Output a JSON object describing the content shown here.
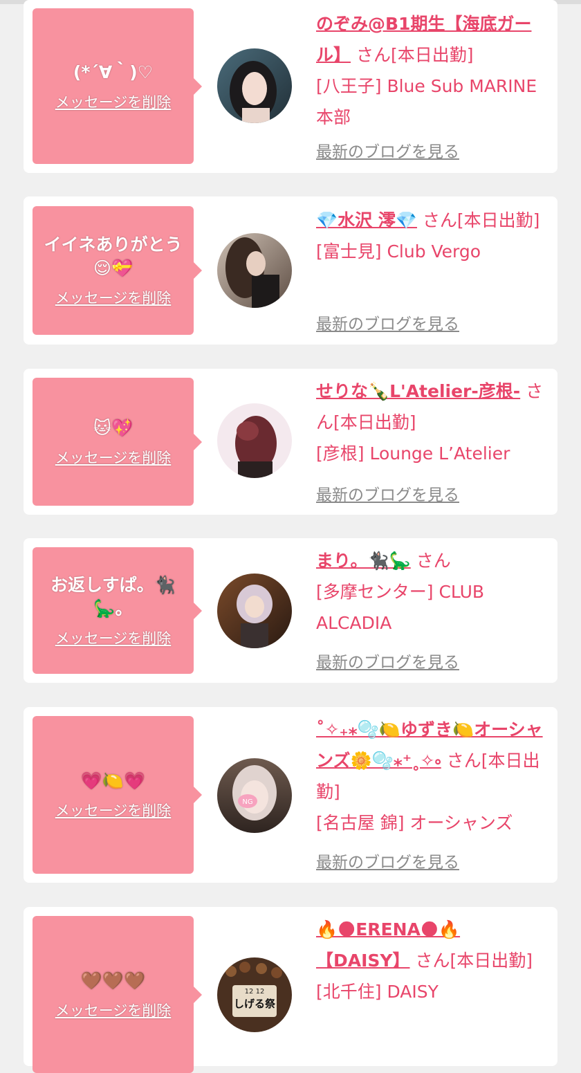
{
  "cards": [
    {
      "bubble_message": "(*´∀｀)♡",
      "delete_label": "メッセージを削除",
      "name": "のぞみ@B1期生【海底ガール】",
      "suffix": "さん[本日出勤]",
      "shop": "[八王子] Blue Sub MARINE 本部",
      "blog_label": "最新のブログを見る",
      "avatar_icon": "avatar-photo"
    },
    {
      "bubble_message": "イイネありがとう😌💝",
      "delete_label": "メッセージを削除",
      "name": "💎水沢 澪💎",
      "suffix": "さん[本日出勤]",
      "shop": "[富士見] Club Vergo",
      "blog_label": "最新のブログを見る",
      "avatar_icon": "avatar-photo"
    },
    {
      "bubble_message": "🐱💖",
      "delete_label": "メッセージを削除",
      "name": "せりな🍾L'Atelier-彦根-",
      "suffix": "さん[本日出勤]",
      "shop": "[彦根] Lounge L’Atelier",
      "blog_label": "最新のブログを見る",
      "avatar_icon": "avatar-photo"
    },
    {
      "bubble_message": "お返しすぱ。🐈‍⬛🦕。",
      "delete_label": "メッセージを削除",
      "name": "まり。🐈‍⬛🦕",
      "suffix": "さん",
      "shop": "[多摩センター] CLUB ALCADIA",
      "blog_label": "最新のブログを見る",
      "avatar_icon": "avatar-photo"
    },
    {
      "bubble_message": "💗🍋💗",
      "delete_label": "メッセージを削除",
      "name": "˚✧₊⁎🫧🍋ゆずき🍋オーシャンズ🌼🫧⁎⁺˳✧༚",
      "suffix": "さん[本日出勤]",
      "shop": "[名古屋 錦] オーシャンズ",
      "blog_label": "最新のブログを見る",
      "avatar_icon": "avatar-photo",
      "avatar_badge": "NG"
    },
    {
      "bubble_message": "🤎🤎🤎",
      "delete_label": "メッセージを削除",
      "name": "🔥🌑ERENA🌑🔥【DAISY】",
      "suffix": "さん[本日出勤]",
      "shop": "[北千住] DAISY",
      "blog_label": "最新のブログを見る",
      "avatar_icon": "avatar-photo",
      "avatar_text": "しげる祭",
      "avatar_date": "12 12"
    }
  ],
  "colors": {
    "background": "#f0f0f0",
    "card": "#ffffff",
    "bubble": "#f8929f",
    "name_text": "#e8456a",
    "blog_link": "#8a8a8a"
  }
}
